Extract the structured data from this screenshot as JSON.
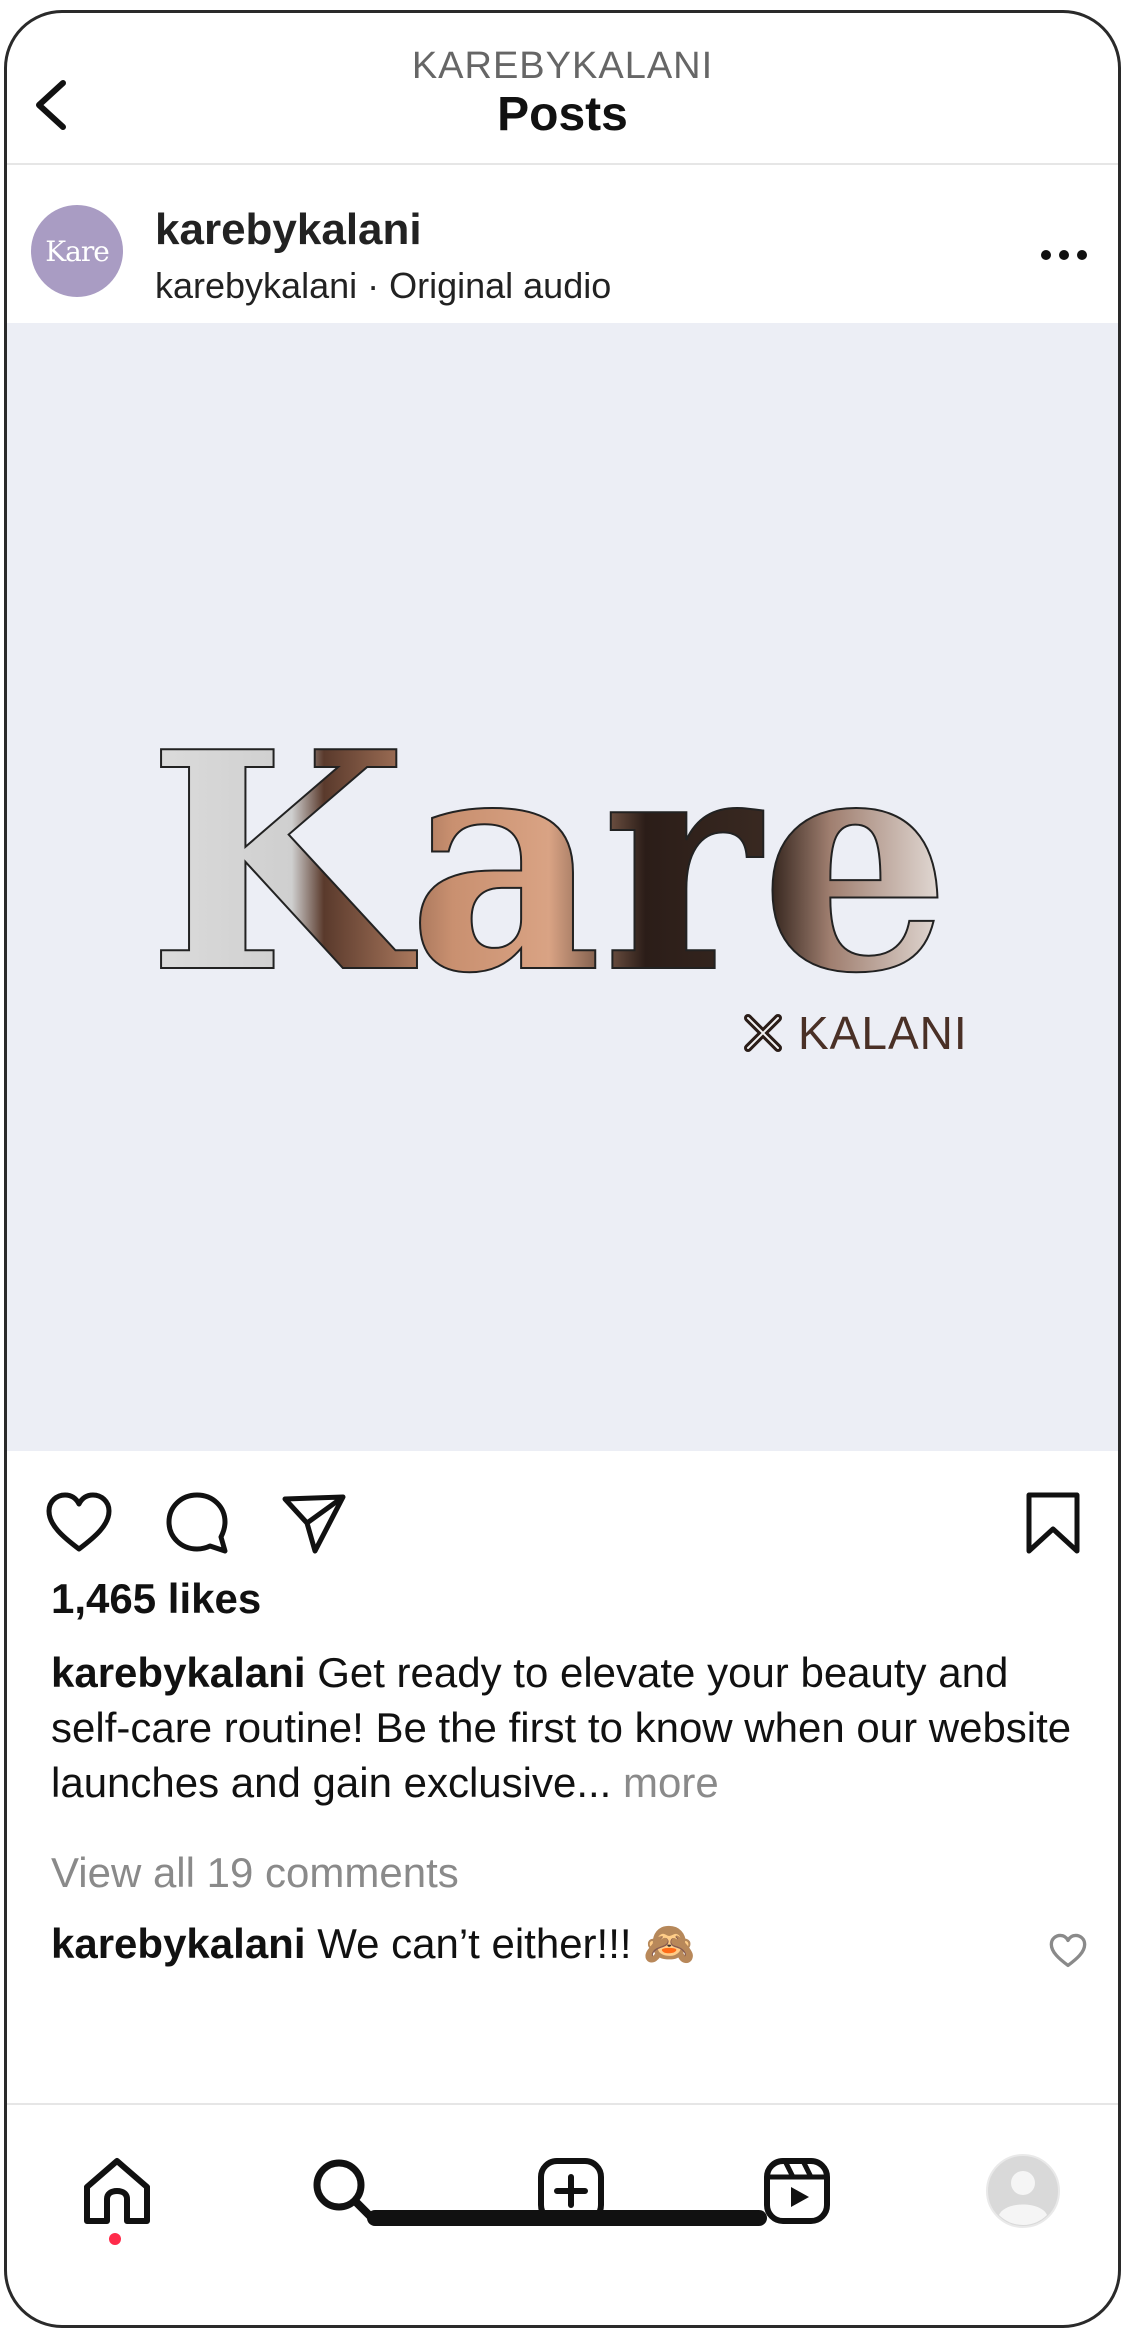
{
  "header": {
    "eyebrow": "KAREBYKALANI",
    "title": "Posts"
  },
  "post": {
    "author": "karebykalani",
    "avatar_text": "Kare",
    "subtitle": "karebykalani · Original audio",
    "media": {
      "logo_text": "Kare",
      "collab_text": "KALANI",
      "background_color": "#eceef5"
    },
    "likes": "1,465 likes",
    "caption": {
      "user": "karebykalani",
      "text": "Get ready to elevate your beauty and self-care routine! Be the first to know when our website launches and gain exclusive...",
      "more": "more"
    },
    "view_comments": "View all 19 comments",
    "comment": {
      "user": "karebykalani",
      "text": "We can’t either!!! 🙈"
    }
  },
  "tabbar": {
    "items": [
      "home",
      "search",
      "create",
      "reels",
      "profile"
    ],
    "active": "home",
    "notification_dot_color": "#ff2b4a"
  },
  "icons": {
    "back": "chevron-left-icon",
    "more": "more-horizontal-icon",
    "like": "heart-icon",
    "comment": "comment-icon",
    "share": "send-icon",
    "save": "bookmark-icon"
  }
}
